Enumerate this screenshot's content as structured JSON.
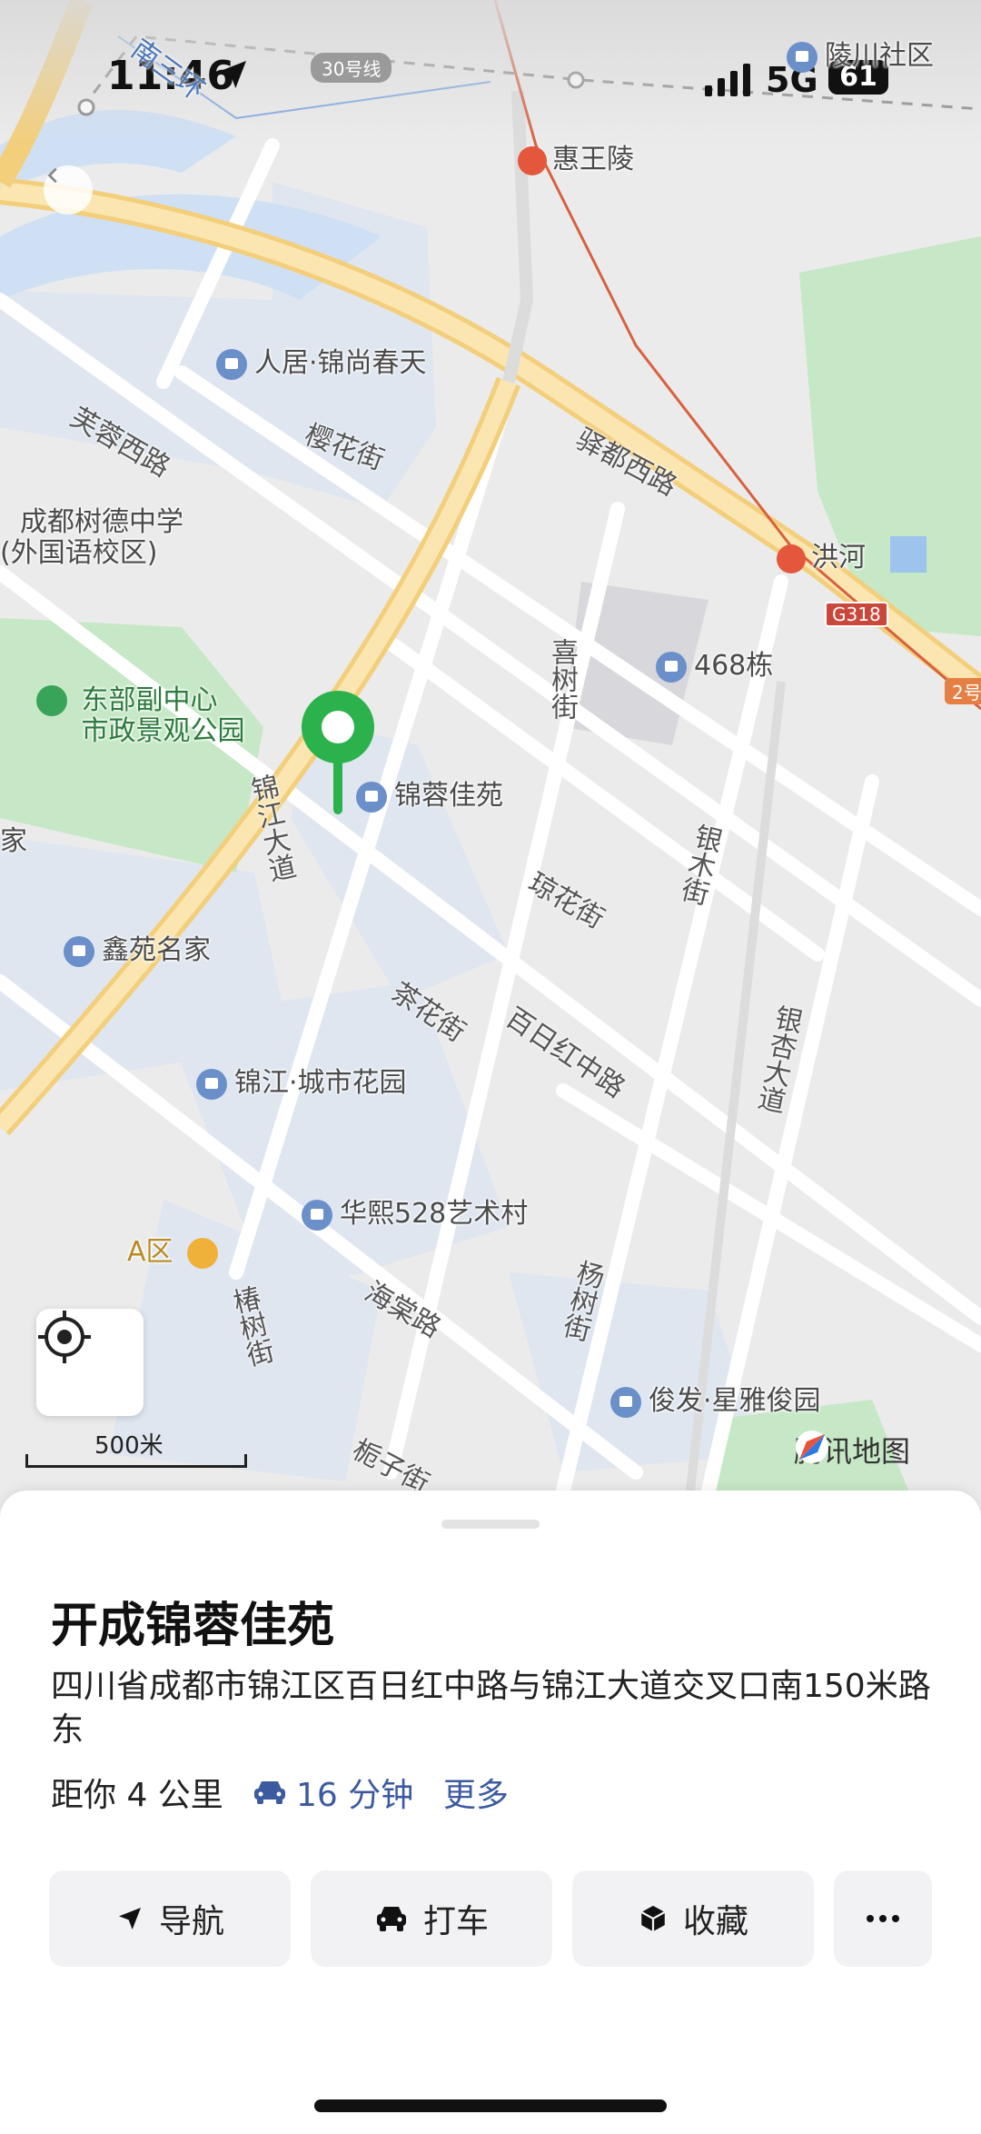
{
  "status_bar": {
    "time": "11:46",
    "network": "5G",
    "battery": "61"
  },
  "map": {
    "labels": {
      "ling_chuan": "陵川社区",
      "hui_wang_ling": "惠王陵",
      "hong_he": "洪河",
      "renju": "人居·锦尚春天",
      "ying_hua": "樱花街",
      "fu_rong": "芙蓉西路",
      "yi_du": "驿都西路",
      "shude_1": "成都树德中学",
      "shude_2": "(外国语校区)",
      "dongbu_1": "东部副中心",
      "dongbu_2": "市政景观公园",
      "b468": "468栋",
      "xi_shu": "喜树街",
      "jinrong": "锦蓉佳苑",
      "jinjiang_dadao": "锦江大道",
      "qiong_hua": "琼花街",
      "yin_mu": "银木街",
      "xin_yuan": "鑫苑名家",
      "cha_hua": "茶花街",
      "bairihong": "百日红中路",
      "yin_xing": "银杏大道",
      "jj_city": "锦江·城市花园",
      "huaxi": "华熙528艺术村",
      "a_qu": "A区",
      "chun_shu": "椿树街",
      "hai_tang": "海棠路",
      "yang_shu": "杨树街",
      "junfa": "俊发·星雅俊园",
      "zhi_zi": "栀子街",
      "line30": "30号线",
      "nan_san": "南三环",
      "jia": "家",
      "g318": "G318",
      "ring2": "2号"
    },
    "scale": "500米",
    "brand": "腾讯地图"
  },
  "sheet": {
    "title": "开成锦蓉佳苑",
    "address": "四川省成都市锦江区百日红中路与锦江大道交叉口南150米路东",
    "distance": "距你 4 公里",
    "drive_time": "16 分钟",
    "more": "更多",
    "buttons": {
      "navigate": "导航",
      "taxi": "打车",
      "favorite": "收藏"
    }
  },
  "colors": {
    "accent": "#3c5aa0",
    "pin": "#2bb24c"
  }
}
